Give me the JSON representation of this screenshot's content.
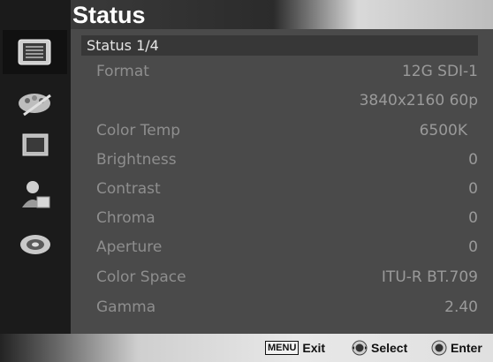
{
  "title": "Status",
  "page_label": "Status 1/4",
  "sidebar": {
    "items": [
      {
        "icon": "status-icon"
      },
      {
        "icon": "color-palette-icon"
      },
      {
        "icon": "display-icon"
      },
      {
        "icon": "user-setup-icon"
      },
      {
        "icon": "system-disc-icon"
      }
    ]
  },
  "rows": [
    {
      "label": "Format",
      "value": "12G SDI-1"
    },
    {
      "label": "",
      "value": "3840x2160 60p"
    },
    {
      "label": "Color Temp",
      "value": "6500K"
    },
    {
      "label": "Brightness",
      "value": "0"
    },
    {
      "label": "Contrast",
      "value": "0"
    },
    {
      "label": "Chroma",
      "value": "0"
    },
    {
      "label": "Aperture",
      "value": "0"
    },
    {
      "label": "Color Space",
      "value": "ITU-R BT.709"
    },
    {
      "label": "Gamma",
      "value": "2.40"
    }
  ],
  "footer": {
    "menu_key": "MENU",
    "exit_label": "Exit",
    "select_label": "Select",
    "enter_label": "Enter"
  }
}
